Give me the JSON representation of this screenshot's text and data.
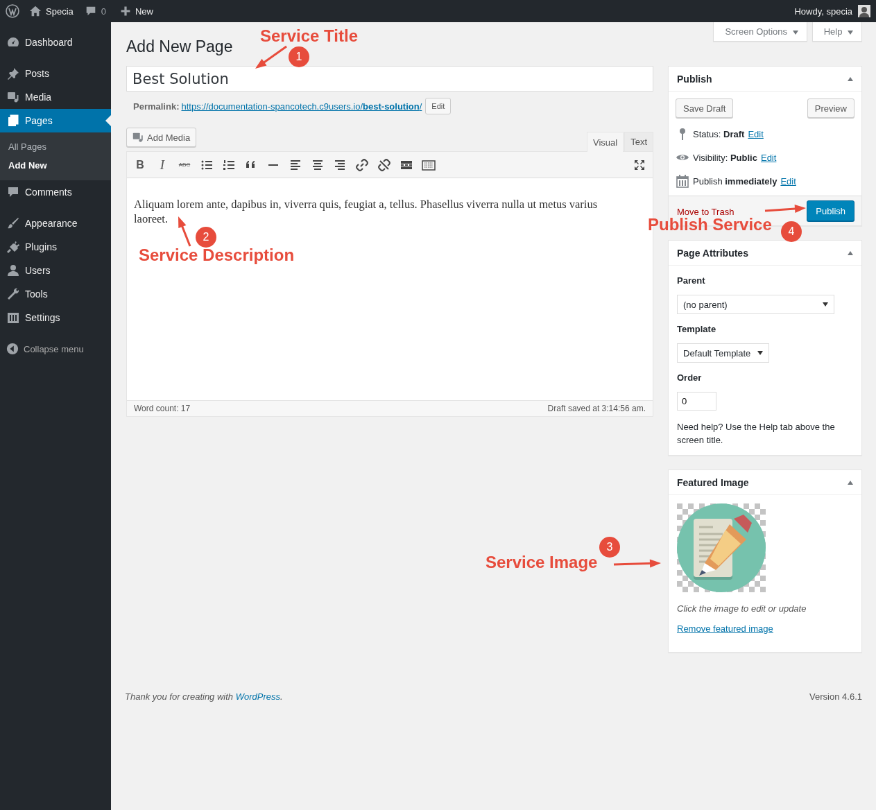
{
  "admin_bar": {
    "site": "Specia",
    "comments": "0",
    "new": "New",
    "greeting": "Howdy, specia"
  },
  "sidebar": {
    "groups": [
      {
        "items": [
          {
            "label": "Dashboard",
            "selected": false
          }
        ]
      },
      {
        "items": [
          {
            "label": "Posts",
            "selected": false
          },
          {
            "label": "Media",
            "selected": false
          },
          {
            "label": "Pages",
            "selected": true,
            "children": [
              {
                "label": "All Pages",
                "selected": false
              },
              {
                "label": "Add New",
                "selected": true
              }
            ]
          },
          {
            "label": "Comments",
            "selected": false
          }
        ]
      },
      {
        "items": [
          {
            "label": "Appearance",
            "selected": false
          },
          {
            "label": "Plugins",
            "selected": false
          },
          {
            "label": "Users",
            "selected": false
          },
          {
            "label": "Tools",
            "selected": false
          },
          {
            "label": "Settings",
            "selected": false
          }
        ]
      }
    ],
    "collapse": "Collapse menu"
  },
  "screen_tabs": [
    "Screen Options",
    "Help"
  ],
  "heading": "Add New Page",
  "title_field": {
    "value": "Best Solution"
  },
  "permalink": {
    "label": "Permalink:",
    "url": "https://documentation-spancotech.c9users.io/**best-solution**/",
    "edit": "Edit"
  },
  "add_media": "Add Media",
  "editor_tabs": [
    {
      "label": "Visual",
      "selected": true
    },
    {
      "label": "Text",
      "selected": false
    }
  ],
  "toolbar": {
    "bold": "B",
    "italic": "I",
    "strike": "ABC"
  },
  "content": "Aliquam lorem ante, dapibus in, viverra quis, feugiat a, tellus. Phasellus viverra nulla ut metus varius laoreet.",
  "word_count": "Word count: 17",
  "draft_saved": "Draft saved at 3:14:56 am.",
  "publish": {
    "title": "Publish",
    "save_draft": "Save Draft",
    "preview": "Preview",
    "rows": [
      {
        "text": "Status: **Draft**",
        "edit": "Edit"
      },
      {
        "text": "Visibility: **Public**",
        "edit": "Edit"
      },
      {
        "text": "Publish **immediately**",
        "edit": "Edit"
      }
    ],
    "trash": "Move to Trash",
    "button": "Publish"
  },
  "page_attributes": {
    "title": "Page Attributes",
    "parent_label": "Parent",
    "parent_value": "(no parent)",
    "template_label": "Template",
    "template_value": "Default Template",
    "order_label": "Order",
    "order_value": "0",
    "help": "Need help? Use the Help tab above the screen title."
  },
  "featured_image": {
    "title": "Featured Image",
    "kind": "picture",
    "caption": "Click the image to edit or update",
    "remove": "Remove featured image"
  },
  "footer": {
    "thanks": "Thank you for creating with",
    "link": "WordPress",
    "end": ".",
    "version": "Version 4.6.1"
  },
  "annotations": [
    {
      "label": "Service Title",
      "number": "1"
    },
    {
      "label": "Service Description",
      "number": "2"
    },
    {
      "label": "Service Image",
      "number": "3"
    },
    {
      "label": "Publish Service",
      "number": "4"
    }
  ]
}
